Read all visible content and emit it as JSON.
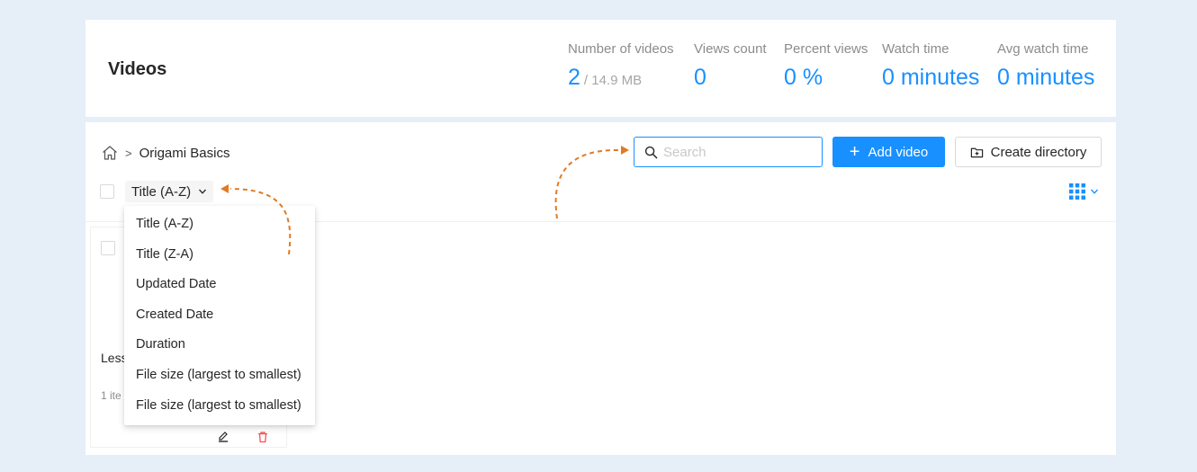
{
  "header": {
    "title": "Videos",
    "stats": [
      {
        "label": "Number of videos",
        "value": "2",
        "sub": "/ 14.9 MB"
      },
      {
        "label": "Views count",
        "value": "0",
        "sub": ""
      },
      {
        "label": "Percent views",
        "value": "0 %",
        "sub": ""
      },
      {
        "label": "Watch time",
        "value": "0 minutes",
        "sub": ""
      },
      {
        "label": "Avg watch time",
        "value": "0 minutes",
        "sub": ""
      }
    ]
  },
  "toolbar": {
    "breadcrumb_sep": ">",
    "breadcrumb_current": "Origami Basics",
    "search_placeholder": "Search",
    "search_value": "",
    "add_video_label": "Add video",
    "create_directory_label": "Create directory",
    "sort_selected": "Title (A-Z)"
  },
  "sort_menu": {
    "options": [
      "Title (A-Z)",
      "Title (Z-A)",
      "Updated Date",
      "Created Date",
      "Duration",
      "File size (largest to smallest)",
      "File size (largest to smallest)"
    ]
  },
  "card": {
    "title_partial": "Less",
    "meta_partial": "1 ite"
  },
  "colors": {
    "accent": "#1890ff",
    "annotation": "#e07b24",
    "delete": "#ff4d4f",
    "background": "#e6eef8"
  },
  "icons": [
    "home-icon",
    "search-icon",
    "plus-icon",
    "folder-plus-icon",
    "chevron-down-icon",
    "grid-icon",
    "edit-icon",
    "delete-icon"
  ]
}
